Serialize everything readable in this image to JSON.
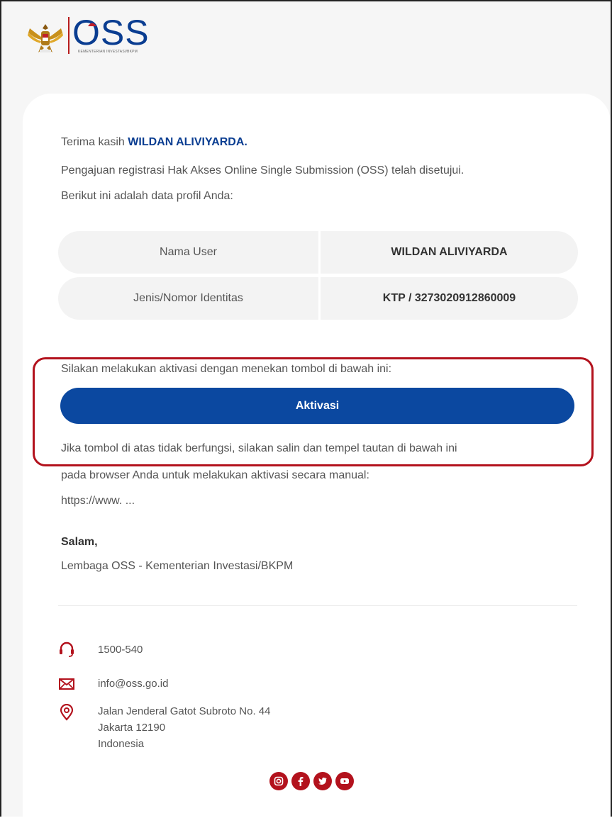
{
  "header": {
    "brand": "OSS",
    "brand_subtitle": "KEMENTERIAN INVESTASI/BKPM"
  },
  "email": {
    "thanks_prefix": "Terima kasih",
    "recipient_name": "WILDAN ALIVIYARDA.",
    "intro_line1": "Pengajuan registrasi Hak Akses Online Single Submission (OSS) telah disetujui.",
    "intro_line2": "Berikut ini adalah data profil Anda:",
    "profile": [
      {
        "label": "Nama User",
        "value": "WILDAN ALIVIYARDA"
      },
      {
        "label": "Jenis/Nomor Identitas",
        "value": "KTP / 3273020912860009"
      }
    ],
    "activation_prompt": "Silakan melakukan aktivasi dengan menekan tombol di bawah ini:",
    "activation_button": "Aktivasi",
    "fallback_line1": "Jika tombol di atas tidak berfungsi, silakan salin dan tempel tautan di bawah ini",
    "fallback_line2": "pada browser Anda untuk melakukan aktivasi secara manual:",
    "fallback_link": "https://www. ...",
    "closing": "Salam,",
    "signature": "Lembaga OSS - Kementerian Investasi/BKPM"
  },
  "footer": {
    "phone": "1500-540",
    "email": "info@oss.go.id",
    "address_line1": "Jalan Jenderal Gatot Subroto No. 44",
    "address_line2": "Jakarta 12190",
    "address_line3": "Indonesia",
    "social_icons": [
      "instagram-icon",
      "facebook-icon",
      "twitter-icon",
      "youtube-icon"
    ]
  },
  "colors": {
    "brand_blue": "#0b48a0",
    "accent_red": "#b3121d",
    "card_bg": "#ffffff",
    "page_bg": "#f6f6f6"
  }
}
